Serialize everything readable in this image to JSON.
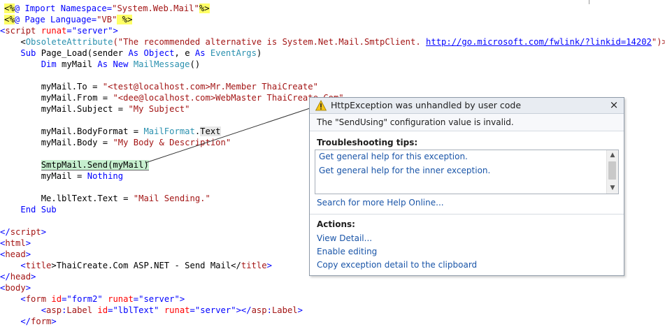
{
  "code_lines": {
    "l1": {
      "a": "<%",
      "b": "@ Import Namespace=",
      "c": "\"System.Web.Mail\"",
      "d": "%>"
    },
    "l2": {
      "a": "<%",
      "b": "@ Page Language=",
      "c": "\"VB\"",
      "d": " %>"
    },
    "l3": {
      "a": "<",
      "b": "script",
      "c": " runat",
      "d": "=\"server\"",
      "e": ">"
    },
    "l4": {
      "a": "    <",
      "b": "ObsoleteAttribute",
      "c": "(\"The recommended alternative is System.Net.Mail.SmtpClient. ",
      "d": "http://go.microsoft.com/fwlink/?linkid=14202",
      "e": "\")>"
    },
    "l5": {
      "a": "    ",
      "b": "Sub",
      "c": " Page_Load(sender ",
      "d": "As",
      "e": " ",
      "f": "Object",
      "g": ", e ",
      "h": "As",
      "i": " ",
      "j": "EventArgs",
      "k": ")"
    },
    "l6": {
      "a": "        ",
      "b": "Dim",
      "c": " myMail ",
      "d": "As",
      "e": " ",
      "f": "New",
      "g": " ",
      "h": "MailMessage",
      "i": "()"
    },
    "l7": {
      "a": "        myMail.To = ",
      "b": "\"<test@localhost.com>Mr.Member ThaiCreate\""
    },
    "l8": {
      "a": "        myMail.From = ",
      "b": "\"<dee@localhost.com>WebMaster ThaiCreate.Com\""
    },
    "l9": {
      "a": "        myMail.Subject = ",
      "b": "\"My Subject\""
    },
    "l10": {
      "a": "        myMail.BodyFormat = ",
      "b": "MailFormat",
      "c": ".",
      "d": "Text"
    },
    "l11": {
      "a": "        myMail.Body = ",
      "b": "\"My Body & Description\""
    },
    "l12": {
      "a": "        ",
      "b": "SmtpMail.Send(myMail)"
    },
    "l13": {
      "a": "        myMail = ",
      "b": "Nothing"
    },
    "l14": {
      "a": "        Me.lblText.Text = ",
      "b": "\"Mail Sending.\""
    },
    "l15": {
      "a": "    ",
      "b": "End Sub"
    },
    "l16": {
      "a": "</",
      "b": "script",
      "c": ">"
    },
    "l17": {
      "a": "<",
      "b": "html",
      "c": ">"
    },
    "l18": {
      "a": "<",
      "b": "head",
      "c": ">"
    },
    "l19": {
      "a": "    <",
      "b": "title",
      "c": ">ThaiCreate.Com ASP.NET - Send Mail</",
      "d": "title",
      "e": ">"
    },
    "l20": {
      "a": "</",
      "b": "head",
      "c": ">"
    },
    "l21": {
      "a": "<",
      "b": "body",
      "c": ">"
    },
    "l22": {
      "a": "    <",
      "b": "form",
      "c": " id",
      "d": "=\"form2\"",
      "e": " runat",
      "f": "=\"server\"",
      "g": ">"
    },
    "l23": {
      "a": "        <",
      "b": "asp",
      "c": ":",
      "d": "Label",
      "e": " id",
      "f": "=\"lblText\"",
      "g": " runat",
      "h": "=\"server\"",
      "i": "></",
      "j": "asp",
      "k": ":",
      "l": "Label",
      "m": ">"
    },
    "l24": {
      "a": "    </",
      "b": "form",
      "c": ">"
    }
  },
  "exception_popup": {
    "title": "HttpException was unhandled by user code",
    "close_glyph": "×",
    "message": "The \"SendUsing\" configuration value is invalid.",
    "tips_heading": "Troubleshooting tips:",
    "tips": [
      "Get general help for this exception.",
      "Get general help for the inner exception."
    ],
    "search_link": "Search for more Help Online...",
    "actions_heading": "Actions:",
    "actions": [
      "View Detail...",
      "Enable editing",
      "Copy exception detail to the clipboard"
    ],
    "scroll_up_glyph": "▲",
    "scroll_down_glyph": "▼",
    "icon": "warning-icon"
  }
}
